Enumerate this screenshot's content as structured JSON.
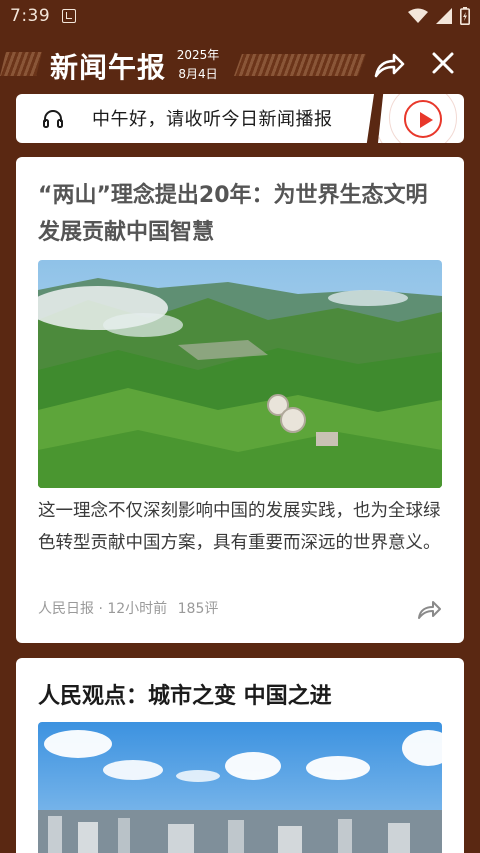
{
  "status_bar": {
    "time": "7:39",
    "icons": [
      "app-notification-icon",
      "wifi-icon",
      "signal-icon",
      "battery-icon"
    ]
  },
  "header": {
    "title": "新闻午报",
    "date_year": "2025年",
    "date_day": "8月4日",
    "share_icon": "share-icon",
    "close_icon": "close-icon"
  },
  "audio_banner": {
    "text": "中午好，请收听今日新闻播报",
    "icon": "headphones-icon",
    "play_icon": "play-icon",
    "accent": "#e8382b"
  },
  "articles": [
    {
      "title": "“两山”理念提出20年：为世界生态文明发展贡献中国智慧",
      "summary": "这一理念不仅深刻影响中国的发展实践，也为全球绿色转型贡献中国方案，具有重要而深远的世界意义。",
      "source": "人民日报",
      "time": "12小时前",
      "comments": "185评",
      "image": "mountain-bamboo-forest-photo"
    },
    {
      "title": "人民观点：城市之变 中国之进",
      "image": "city-skyline-photo"
    }
  ],
  "colors": {
    "background": "#5a2812",
    "card": "#ffffff",
    "accent": "#e8382b"
  }
}
